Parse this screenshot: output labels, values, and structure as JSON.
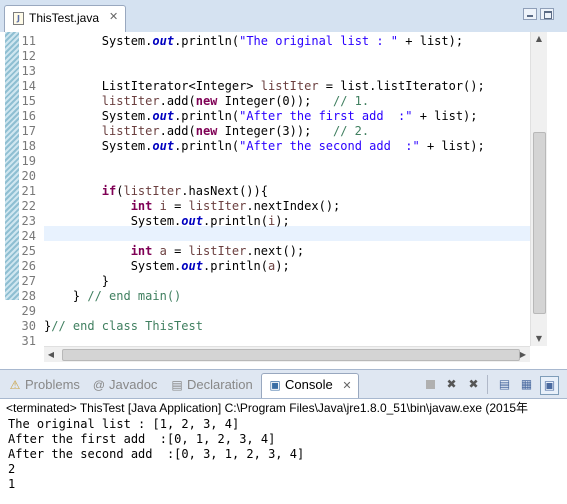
{
  "editor": {
    "tab_title": "ThisTest.java",
    "tab_close": "✕",
    "file_icon": "J",
    "lines": [
      {
        "num": "11",
        "html": "        System.<span class=\"fi\">out</span>.println(<span class=\"st\">\"The original list : \"</span> + list);"
      },
      {
        "num": "12",
        "html": ""
      },
      {
        "num": "13",
        "html": ""
      },
      {
        "num": "14",
        "html": "        ListIterator&lt;Integer&gt; <span class=\"lv\">listIter</span> = list.listIterator();"
      },
      {
        "num": "15",
        "html": "        <span class=\"lv\">listIter</span>.add(<span class=\"kw\">new</span> Integer(0));   <span class=\"cm\">// 1.</span>"
      },
      {
        "num": "16",
        "html": "        System.<span class=\"fi\">out</span>.println(<span class=\"st\">\"After the first add  :\"</span> + list);"
      },
      {
        "num": "17",
        "html": "        <span class=\"lv\">listIter</span>.add(<span class=\"kw\">new</span> Integer(3));   <span class=\"cm\">// 2.</span>"
      },
      {
        "num": "18",
        "html": "        System.<span class=\"fi\">out</span>.println(<span class=\"st\">\"After the second add  :\"</span> + list);"
      },
      {
        "num": "19",
        "html": ""
      },
      {
        "num": "20",
        "html": ""
      },
      {
        "num": "21",
        "html": "        <span class=\"kw\">if</span>(<span class=\"lv\">listIter</span>.hasNext()){"
      },
      {
        "num": "22",
        "html": "            <span class=\"kw\">int</span> <span class=\"lv\">i</span> = <span class=\"lv\">listIter</span>.nextIndex();"
      },
      {
        "num": "23",
        "html": "            System.<span class=\"fi\">out</span>.println(<span class=\"lv\">i</span>);"
      },
      {
        "num": "24",
        "html": ""
      },
      {
        "num": "25",
        "html": "            <span class=\"kw\">int</span> <span class=\"lv\">a</span> = <span class=\"lv\">listIter</span>.next();"
      },
      {
        "num": "26",
        "html": "            System.<span class=\"fi\">out</span>.println(<span class=\"lv\">a</span>);"
      },
      {
        "num": "27",
        "html": "        }"
      },
      {
        "num": "28",
        "html": "    } <span class=\"cm\">// end main()</span>"
      },
      {
        "num": "29",
        "html": ""
      },
      {
        "num": "30",
        "html": "}<span class=\"cm\">// end class ThisTest</span>"
      },
      {
        "num": "31",
        "html": ""
      }
    ]
  },
  "views": {
    "tabs": [
      {
        "id": "problems",
        "label": "Problems",
        "icon": "⚠"
      },
      {
        "id": "javadoc",
        "label": "Javadoc",
        "icon": "@"
      },
      {
        "id": "declaration",
        "label": "Declaration",
        "icon": "▤"
      },
      {
        "id": "console",
        "label": "Console",
        "icon": "▣",
        "close": "✕",
        "active": true
      }
    ],
    "toolbar_icons": [
      "terminate-icon",
      "remove-launch-icon",
      "remove-all-terminated-icon",
      "scroll-lock-icon",
      "pin-console-icon",
      "display-console-icon"
    ]
  },
  "console": {
    "status": "<terminated> ThisTest [Java Application] C:\\Program Files\\Java\\jre1.8.0_51\\bin\\javaw.exe (2015年",
    "output": [
      "The original list : [1, 2, 3, 4]",
      "After the first add  :[0, 1, 2, 3, 4]",
      "After the second add  :[0, 3, 1, 2, 3, 4]",
      "2",
      "1"
    ]
  },
  "colors": {
    "keyword": "#7f0055",
    "string": "#2a00ff",
    "comment": "#3f7f5f",
    "field": "#0000c0",
    "current_line": "#e8f2fe"
  }
}
